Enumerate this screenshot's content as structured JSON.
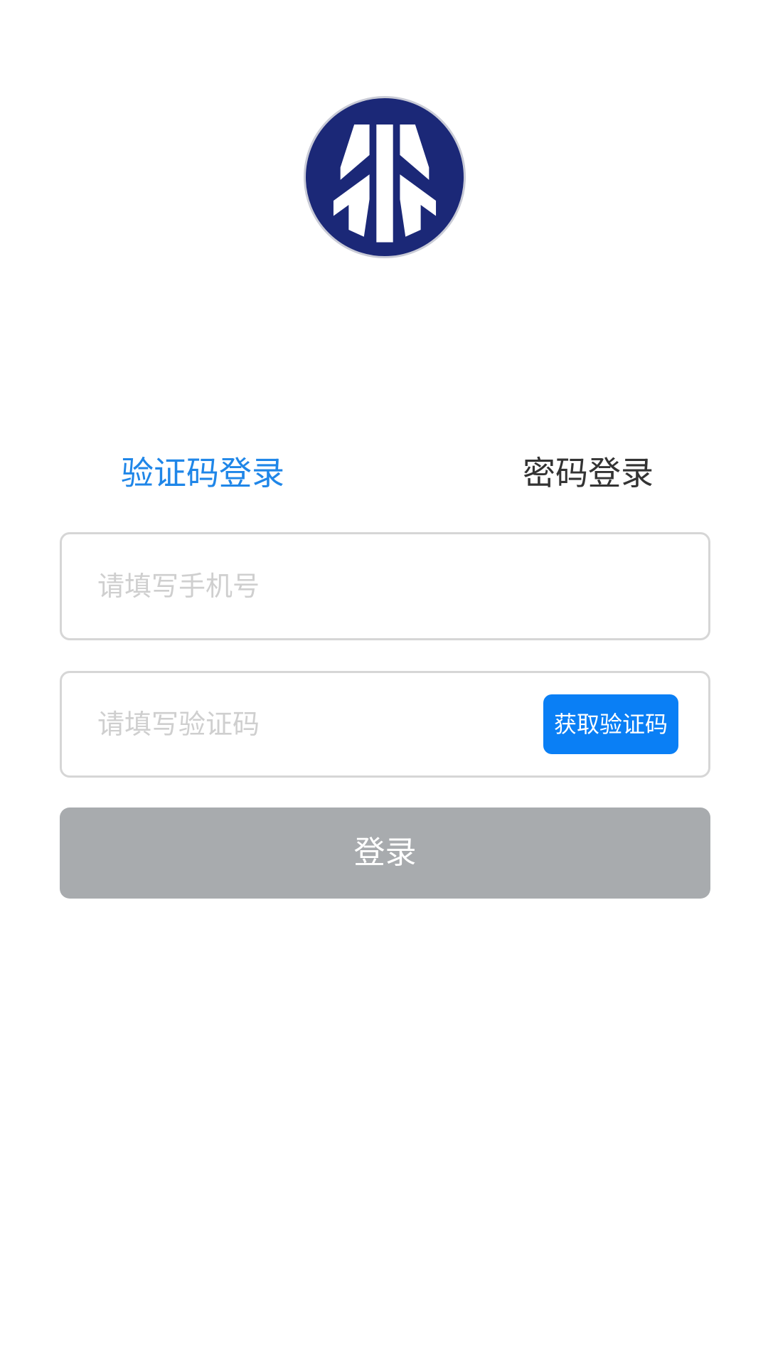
{
  "logo": {
    "icon": "arrow-trident-logo",
    "color": "#1b2877"
  },
  "tabs": {
    "sms_login": "验证码登录",
    "password_login": "密码登录",
    "active_color": "#1f86e8"
  },
  "phone_field": {
    "placeholder": "请填写手机号",
    "value": ""
  },
  "code_field": {
    "placeholder": "请填写验证码",
    "value": ""
  },
  "get_code_button": {
    "label": "获取验证码",
    "color": "#0a7ff5"
  },
  "login_button": {
    "label": "登录",
    "color": "#a8abae"
  }
}
